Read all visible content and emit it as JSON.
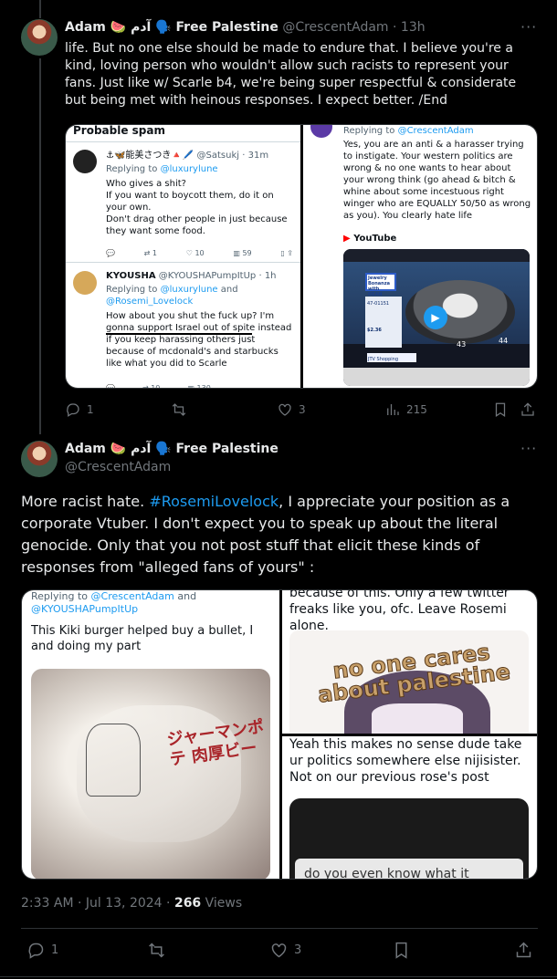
{
  "tweet1": {
    "author_name": "Adam 🍉 آدم 🗣️ Free Palestine",
    "handle": "@CrescentAdam",
    "time": "13h",
    "text": "life. But no one else should be made to endure that. I believe you're a kind, loving person who wouldn't allow such racists to represent your fans. Just like w/ Scarle b4, we're being super respectful & considerate but being met with heinous responses. I expect better. /End",
    "left_panel": {
      "header": "Probable spam",
      "reply1": {
        "name": "⚓🦋能美さつき🔺🖊️",
        "handle": "@Satsukj",
        "time": "31m",
        "replying_prefix": "Replying to",
        "replying_to": "@luxurylune",
        "body": "Who gives a shit?\nIf you want to boycott them, do it on your own.\nDon't drag other people in just because they want some food.",
        "stats": [
          "1",
          "10",
          "59"
        ]
      },
      "reply2": {
        "name": "KYOUSHA",
        "handle": "@KYOUSHAPumpItUp",
        "time": "1h",
        "replying_prefix": "Replying to",
        "replying_to_1": "@luxurylune",
        "replying_and": "and",
        "replying_to_2": "@Rosemi_Lovelock",
        "body": "How about you shut the fuck up? I'm gonna support Israel out of spite instead if you keep harassing others just because of mcdonald's and starbucks like what you did to Scarle",
        "stats": [
          "10",
          "130"
        ]
      }
    },
    "right_panel": {
      "replying_prefix": "Replying to",
      "replying_to": "@CrescentAdam",
      "body": "Yes, you are an anti & a harasser trying to instigate. Your western politics are wrong & no one wants to hear about your wrong think (go ahead & bitch & whine about some incestuous right winger who are EQUALLY 50/50 as wrong as you). You clearly hate life",
      "source": "YouTube",
      "video_sign": "Jewelry Bonanza with DEAN",
      "video_price": "$2.36",
      "video_item": "47-01151",
      "video_network": "JTV Shopping Network",
      "video_numbers": [
        "43",
        "44"
      ]
    },
    "actions": {
      "replies": "1",
      "retweets": "",
      "likes": "3",
      "views": "215"
    }
  },
  "tweet2": {
    "author_name": "Adam 🍉 آدم 🗣️ Free Palestine",
    "handle": "@CrescentAdam",
    "text_before": "More racist hate. ",
    "hashtag": "#RosemiLovelock",
    "text_after": ", I appreciate your position as a corporate Vtuber. I don't expect you to speak up about the literal genocide. Only that you not post stuff that elicit these kinds of responses from \"alleged fans of yours\" :",
    "left_panel": {
      "replying_prefix": "Replying to",
      "replying_to_1": "@CrescentAdam",
      "replying_and": "and",
      "replying_to_2": "@KYOUSHAPumpItUp",
      "body": "This Kiki burger helped buy a bullet, I and doing my part",
      "wrapper_text": "ジャーマンポテ 肉厚ビー"
    },
    "top_right_panel": {
      "body": "because of this. Only a few twitter freaks like you, ofc. Leave Rosemi alone.",
      "sticker_text": "no one cares about palestine"
    },
    "bottom_right_panel": {
      "body": "Yeah this makes no sense dude take ur politics somewhere else nijisister. Not on our previous rose's post",
      "image_text": "do you even know what it"
    },
    "timestamp": "2:33 AM · Jul 13, 2024",
    "view_count": "266",
    "views_label": "Views",
    "actions": {
      "replies": "1",
      "retweets": "",
      "likes": "3"
    }
  },
  "colors": {
    "accent": "#1d9bf0",
    "muted": "#71767b",
    "border": "#2f3336"
  }
}
